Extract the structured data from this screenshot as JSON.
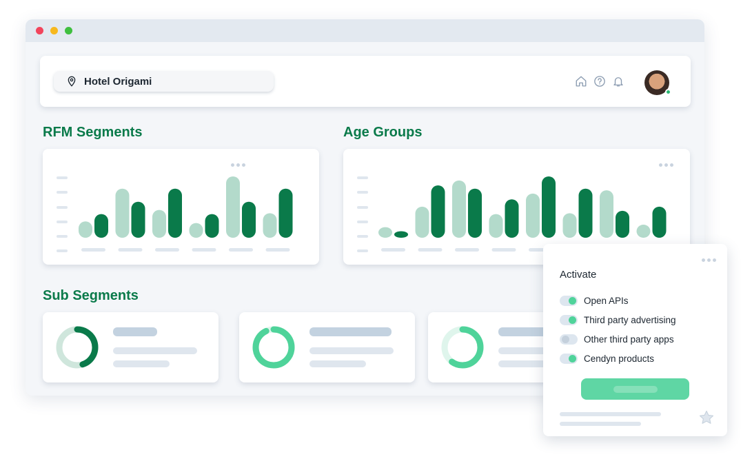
{
  "window": {
    "controls": [
      "close",
      "minimize",
      "maximize"
    ]
  },
  "header": {
    "location_label": "Hotel Origami",
    "icons": [
      "home-icon",
      "help-icon",
      "bell-icon"
    ],
    "user_status": "online"
  },
  "sections": {
    "rfm_title": "RFM Segments",
    "age_title": "Age Groups",
    "sub_title": "Sub Segments"
  },
  "chart_data": [
    {
      "type": "bar",
      "title": "RFM Segments",
      "categories": [
        "",
        "",
        "",
        "",
        "",
        ""
      ],
      "series": [
        {
          "values": [
            20,
            60,
            34,
            18,
            75,
            30
          ]
        },
        {
          "values": [
            29,
            44,
            60,
            29,
            44,
            60
          ]
        }
      ],
      "ylim": [
        0,
        80
      ],
      "colors": [
        "#b3dacb",
        "#0a7a4a"
      ],
      "legend": "none"
    },
    {
      "type": "bar",
      "title": "Age Groups",
      "categories": [
        "",
        "",
        "",
        "",
        "",
        "",
        "",
        ""
      ],
      "series": [
        {
          "values": [
            13,
            38,
            70,
            29,
            54,
            30,
            58,
            16
          ]
        },
        {
          "values": [
            8,
            64,
            60,
            47,
            75,
            60,
            33,
            38
          ]
        }
      ],
      "ylim": [
        0,
        80
      ],
      "colors": [
        "#b3dacb",
        "#0a7a4a"
      ],
      "legend": "none"
    }
  ],
  "sub_segments": [
    {
      "progress": 0.45,
      "color": "#0a7a4a",
      "track": "#cfe6dc"
    },
    {
      "progress": 0.93,
      "color": "#4fd39a",
      "track": "#dff5ec"
    },
    {
      "progress": 0.6,
      "color": "#4fd39a",
      "track": "#dff5ec"
    }
  ],
  "activate": {
    "title": "Activate",
    "options": [
      {
        "label": "Open APIs",
        "enabled": true
      },
      {
        "label": "Third party advertising",
        "enabled": true
      },
      {
        "label": "Other third party apps",
        "enabled": false
      },
      {
        "label": "Cendyn products",
        "enabled": true
      }
    ]
  }
}
